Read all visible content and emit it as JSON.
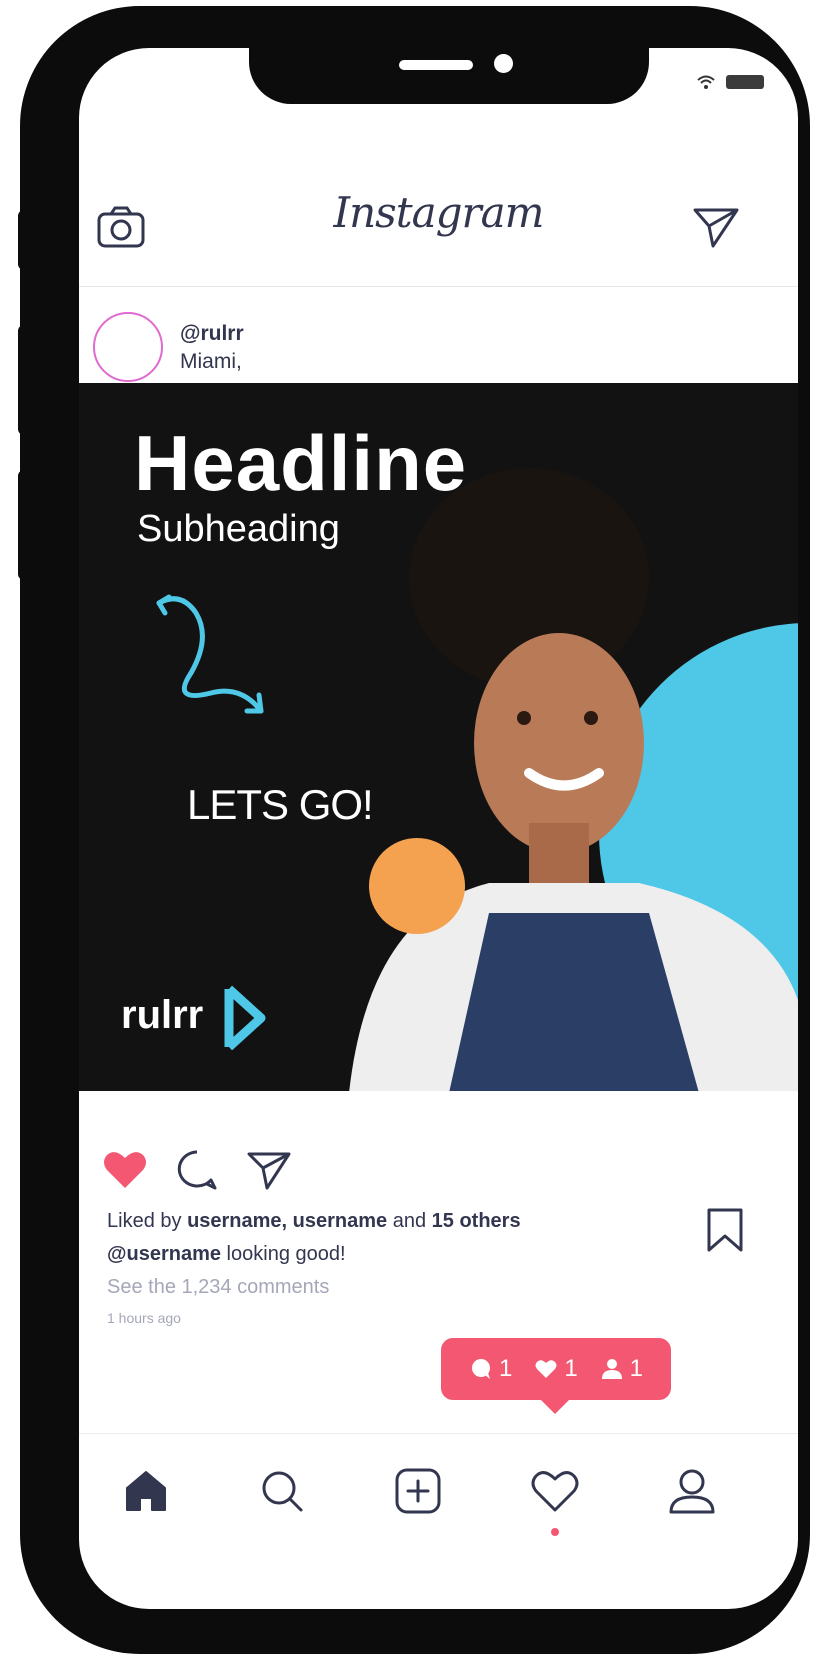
{
  "header": {
    "logo_text": "Instagram"
  },
  "post": {
    "username": "@rulrr",
    "location": "Miami,",
    "image": {
      "headline": "Headline",
      "subheading": "Subheading",
      "cta": "LETS GO!",
      "brand": "rulrr"
    },
    "likes": {
      "prefix": "Liked by ",
      "users": "username, username",
      "mid": " and ",
      "others": "15 others"
    },
    "caption": {
      "username": "@username",
      "text": " looking good!"
    },
    "comments_link": "See the 1,234 comments",
    "timestamp": "1 hours ago"
  },
  "notification": {
    "comments": "1",
    "likes": "1",
    "followers": "1"
  },
  "colors": {
    "accent": "#f35772",
    "text": "#33364f",
    "muted": "#a4a7b8",
    "cyan": "#4fc8e8",
    "orange": "#f4a24f"
  }
}
